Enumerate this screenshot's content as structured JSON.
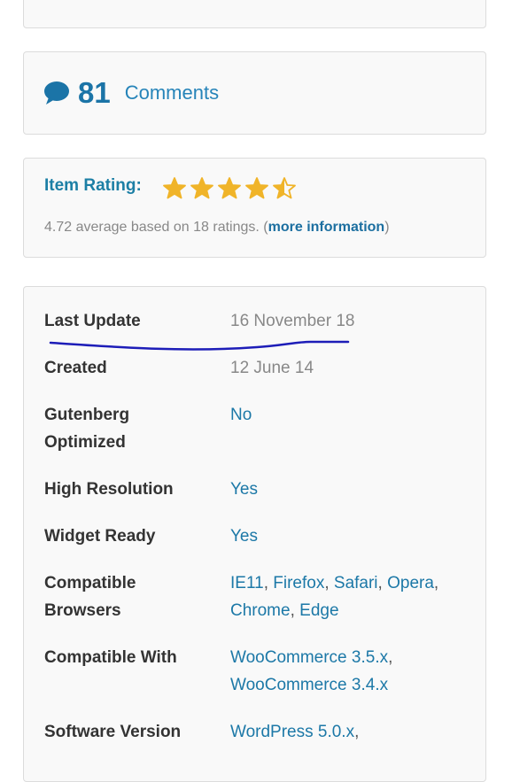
{
  "comments": {
    "count": "81",
    "label": "Comments"
  },
  "rating": {
    "title": "Item Rating:",
    "stars": 4.5,
    "summary_prefix": "4.72 average based on 18 ratings. (",
    "more_link": "more information",
    "summary_suffix": ")"
  },
  "meta": {
    "last_update_label": "Last Update",
    "last_update_value": "16 November 18",
    "created_label": "Created",
    "created_value": "12 June 14",
    "gutenberg_label_1": "Gutenberg",
    "gutenberg_label_2": "Optimized",
    "gutenberg_value": "No",
    "high_res_label": "High Resolution",
    "high_res_value": "Yes",
    "widget_label": "Widget Ready",
    "widget_value": "Yes",
    "browsers_label_1": "Compatible",
    "browsers_label_2": "Browsers",
    "browsers": [
      "IE11",
      "Firefox",
      "Safari",
      "Opera",
      "Chrome",
      "Edge"
    ],
    "compat_label": "Compatible With",
    "compat_1": "WooCommerce 3.5.x",
    "compat_2": "WooCommerce 3.4.x",
    "software_label": "Software Version",
    "software_1": "WordPress 5.0.x"
  },
  "colors": {
    "link": "#1c78a7",
    "star": "#f0b429",
    "annotation": "#1d1db8"
  }
}
